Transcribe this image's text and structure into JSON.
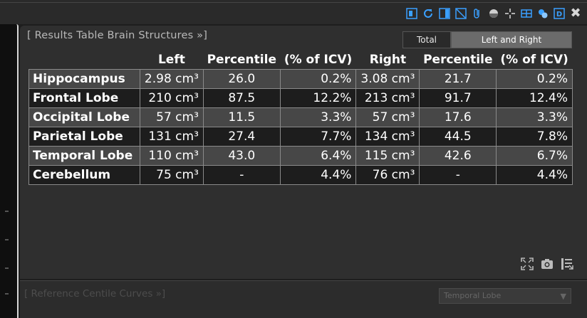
{
  "panel": {
    "title": "[ Results Table Brain Structures »]",
    "tabs": [
      {
        "label": "Total",
        "active": false
      },
      {
        "label": "Left and Right",
        "active": true
      }
    ]
  },
  "table": {
    "headers": [
      "",
      "Left",
      "Percentile",
      "(% of ICV)",
      "Right",
      "Percentile",
      "(% of ICV)"
    ],
    "rows": [
      {
        "name": "Hippocampus",
        "left": "2.98 cm³",
        "left_pct": "26.0",
        "left_icv": "0.2%",
        "right": "3.08 cm³",
        "right_pct": "21.7",
        "right_icv": "0.2%"
      },
      {
        "name": "Frontal Lobe",
        "left": "210 cm³",
        "left_pct": "87.5",
        "left_icv": "12.2%",
        "right": "213 cm³",
        "right_pct": "91.7",
        "right_icv": "12.4%"
      },
      {
        "name": "Occipital Lobe",
        "left": "57 cm³",
        "left_pct": "11.5",
        "left_icv": "3.3%",
        "right": "57 cm³",
        "right_pct": "17.6",
        "right_icv": "3.3%"
      },
      {
        "name": "Parietal Lobe",
        "left": "131 cm³",
        "left_pct": "27.4",
        "left_icv": "7.7%",
        "right": "134 cm³",
        "right_pct": "44.5",
        "right_icv": "7.8%"
      },
      {
        "name": "Temporal Lobe",
        "left": "110 cm³",
        "left_pct": "43.0",
        "left_icv": "6.4%",
        "right": "115 cm³",
        "right_pct": "42.6",
        "right_icv": "6.7%"
      },
      {
        "name": "Cerebellum",
        "left": "75 cm³",
        "left_pct": "-",
        "left_icv": "4.4%",
        "right": "76 cm³",
        "right_pct": "-",
        "right_icv": "4.4%"
      }
    ]
  },
  "toolbar": {
    "icons": [
      "layout-icon",
      "refresh-icon",
      "split-view-icon",
      "crop-icon",
      "attach-icon",
      "contrast-icon",
      "crosshair-icon",
      "grid-icon",
      "link-icon",
      "d-icon",
      "close-icon"
    ]
  },
  "bottom_icons": [
    "expand-icon",
    "camera-icon",
    "export-icon"
  ],
  "panel2": {
    "title": "[ Reference Centile Curves »]",
    "dropdown_value": "Temporal Lobe"
  },
  "colors": {
    "background": "#1e1e1e",
    "panel": "#2f2f2f",
    "row_even": "#474747",
    "row_odd": "#1d1d1d",
    "accent_icon": "#3aa0ff"
  }
}
